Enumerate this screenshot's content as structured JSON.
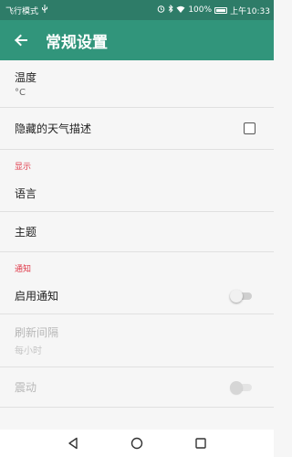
{
  "status_bar": {
    "left_text": "飞行模式",
    "battery": "100%",
    "time": "上午10:33"
  },
  "app_bar": {
    "title": "常规设置"
  },
  "settings": {
    "temperature": {
      "title": "温度",
      "value": "°C"
    },
    "hide_weather": {
      "title": "隐藏的天气描述",
      "checked": false
    },
    "display_header": "显示",
    "language": {
      "title": "语言"
    },
    "theme": {
      "title": "主题"
    },
    "notify_header": "通知",
    "enable_notify": {
      "title": "启用通知",
      "on": false
    },
    "refresh_interval": {
      "title": "刷新间隔",
      "value": "每小时",
      "enabled": false
    },
    "vibrate": {
      "title": "震动",
      "on": false,
      "enabled": false
    }
  },
  "colors": {
    "status_bar": "#2e7c68",
    "app_bar": "#31957b",
    "section_header": "#e03a4a"
  },
  "icons": {
    "back": "arrow-left-icon",
    "nav_back": "triangle-back-icon",
    "nav_home": "circle-home-icon",
    "nav_recent": "square-recent-icon"
  }
}
